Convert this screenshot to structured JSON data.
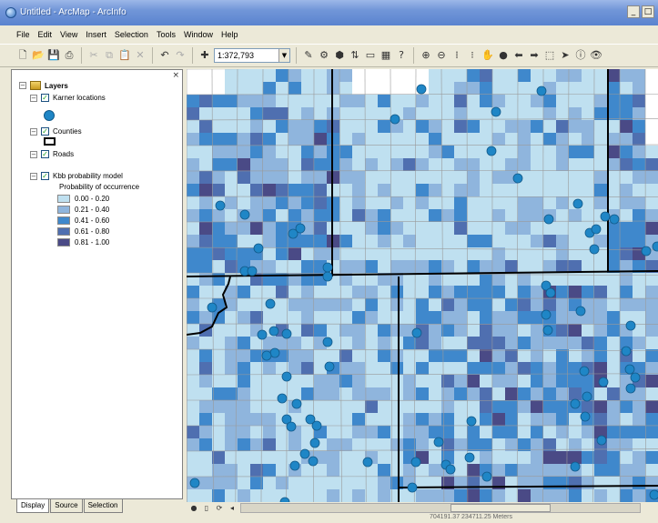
{
  "window": {
    "title": "Untitled - ArcMap - ArcInfo",
    "min": "_",
    "max": "□",
    "close": "×"
  },
  "menu": [
    "File",
    "Edit",
    "View",
    "Insert",
    "Selection",
    "Tools",
    "Window",
    "Help"
  ],
  "toolbar": {
    "scale": "1:372,793"
  },
  "toc": {
    "root": "Layers",
    "layers": [
      {
        "name": "Karner locations"
      },
      {
        "name": "Counties"
      },
      {
        "name": "Roads"
      },
      {
        "name": "Kbb probability model",
        "subtitle": "Probability of occurrence"
      }
    ],
    "legend": [
      {
        "label": "0.00 - 0.20",
        "color": "#bfe0f0"
      },
      {
        "label": "0.21 - 0.40",
        "color": "#8fb5dd"
      },
      {
        "label": "0.41 - 0.60",
        "color": "#3f88cc"
      },
      {
        "label": "0.61 - 0.80",
        "color": "#4f6fb0"
      },
      {
        "label": "0.81 - 1.00",
        "color": "#4a4a86"
      }
    ],
    "tabs": [
      "Display",
      "Source",
      "Selection"
    ]
  },
  "status": {
    "coords": "704191.37 234711.25 Meters"
  },
  "colors": {
    "point": "#1f86c6",
    "county_line": "#000000",
    "road": "#9a9a9a"
  }
}
